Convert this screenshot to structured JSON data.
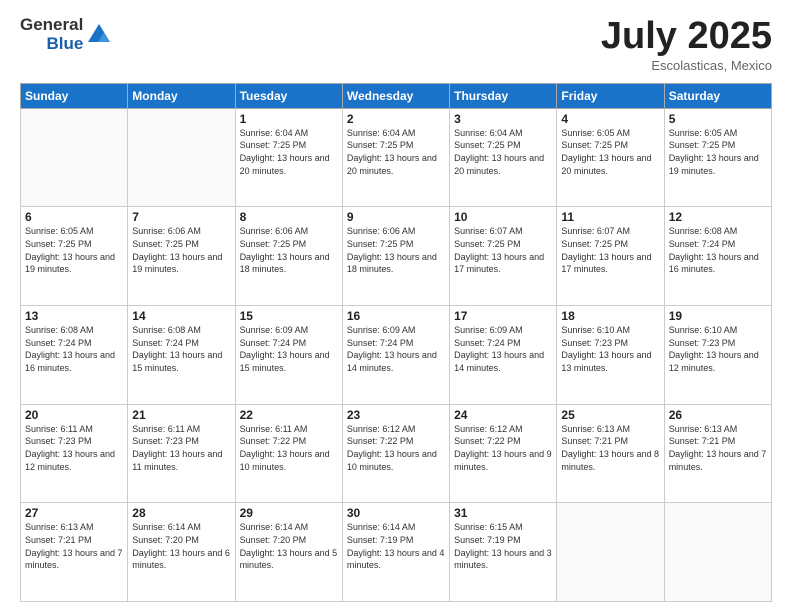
{
  "logo": {
    "general": "General",
    "blue": "Blue"
  },
  "title": "July 2025",
  "location": "Escolasticas, Mexico",
  "days_header": [
    "Sunday",
    "Monday",
    "Tuesday",
    "Wednesday",
    "Thursday",
    "Friday",
    "Saturday"
  ],
  "weeks": [
    [
      {
        "day": "",
        "info": ""
      },
      {
        "day": "",
        "info": ""
      },
      {
        "day": "1",
        "info": "Sunrise: 6:04 AM\nSunset: 7:25 PM\nDaylight: 13 hours and 20 minutes."
      },
      {
        "day": "2",
        "info": "Sunrise: 6:04 AM\nSunset: 7:25 PM\nDaylight: 13 hours and 20 minutes."
      },
      {
        "day": "3",
        "info": "Sunrise: 6:04 AM\nSunset: 7:25 PM\nDaylight: 13 hours and 20 minutes."
      },
      {
        "day": "4",
        "info": "Sunrise: 6:05 AM\nSunset: 7:25 PM\nDaylight: 13 hours and 20 minutes."
      },
      {
        "day": "5",
        "info": "Sunrise: 6:05 AM\nSunset: 7:25 PM\nDaylight: 13 hours and 19 minutes."
      }
    ],
    [
      {
        "day": "6",
        "info": "Sunrise: 6:05 AM\nSunset: 7:25 PM\nDaylight: 13 hours and 19 minutes."
      },
      {
        "day": "7",
        "info": "Sunrise: 6:06 AM\nSunset: 7:25 PM\nDaylight: 13 hours and 19 minutes."
      },
      {
        "day": "8",
        "info": "Sunrise: 6:06 AM\nSunset: 7:25 PM\nDaylight: 13 hours and 18 minutes."
      },
      {
        "day": "9",
        "info": "Sunrise: 6:06 AM\nSunset: 7:25 PM\nDaylight: 13 hours and 18 minutes."
      },
      {
        "day": "10",
        "info": "Sunrise: 6:07 AM\nSunset: 7:25 PM\nDaylight: 13 hours and 17 minutes."
      },
      {
        "day": "11",
        "info": "Sunrise: 6:07 AM\nSunset: 7:25 PM\nDaylight: 13 hours and 17 minutes."
      },
      {
        "day": "12",
        "info": "Sunrise: 6:08 AM\nSunset: 7:24 PM\nDaylight: 13 hours and 16 minutes."
      }
    ],
    [
      {
        "day": "13",
        "info": "Sunrise: 6:08 AM\nSunset: 7:24 PM\nDaylight: 13 hours and 16 minutes."
      },
      {
        "day": "14",
        "info": "Sunrise: 6:08 AM\nSunset: 7:24 PM\nDaylight: 13 hours and 15 minutes."
      },
      {
        "day": "15",
        "info": "Sunrise: 6:09 AM\nSunset: 7:24 PM\nDaylight: 13 hours and 15 minutes."
      },
      {
        "day": "16",
        "info": "Sunrise: 6:09 AM\nSunset: 7:24 PM\nDaylight: 13 hours and 14 minutes."
      },
      {
        "day": "17",
        "info": "Sunrise: 6:09 AM\nSunset: 7:24 PM\nDaylight: 13 hours and 14 minutes."
      },
      {
        "day": "18",
        "info": "Sunrise: 6:10 AM\nSunset: 7:23 PM\nDaylight: 13 hours and 13 minutes."
      },
      {
        "day": "19",
        "info": "Sunrise: 6:10 AM\nSunset: 7:23 PM\nDaylight: 13 hours and 12 minutes."
      }
    ],
    [
      {
        "day": "20",
        "info": "Sunrise: 6:11 AM\nSunset: 7:23 PM\nDaylight: 13 hours and 12 minutes."
      },
      {
        "day": "21",
        "info": "Sunrise: 6:11 AM\nSunset: 7:23 PM\nDaylight: 13 hours and 11 minutes."
      },
      {
        "day": "22",
        "info": "Sunrise: 6:11 AM\nSunset: 7:22 PM\nDaylight: 13 hours and 10 minutes."
      },
      {
        "day": "23",
        "info": "Sunrise: 6:12 AM\nSunset: 7:22 PM\nDaylight: 13 hours and 10 minutes."
      },
      {
        "day": "24",
        "info": "Sunrise: 6:12 AM\nSunset: 7:22 PM\nDaylight: 13 hours and 9 minutes."
      },
      {
        "day": "25",
        "info": "Sunrise: 6:13 AM\nSunset: 7:21 PM\nDaylight: 13 hours and 8 minutes."
      },
      {
        "day": "26",
        "info": "Sunrise: 6:13 AM\nSunset: 7:21 PM\nDaylight: 13 hours and 7 minutes."
      }
    ],
    [
      {
        "day": "27",
        "info": "Sunrise: 6:13 AM\nSunset: 7:21 PM\nDaylight: 13 hours and 7 minutes."
      },
      {
        "day": "28",
        "info": "Sunrise: 6:14 AM\nSunset: 7:20 PM\nDaylight: 13 hours and 6 minutes."
      },
      {
        "day": "29",
        "info": "Sunrise: 6:14 AM\nSunset: 7:20 PM\nDaylight: 13 hours and 5 minutes."
      },
      {
        "day": "30",
        "info": "Sunrise: 6:14 AM\nSunset: 7:19 PM\nDaylight: 13 hours and 4 minutes."
      },
      {
        "day": "31",
        "info": "Sunrise: 6:15 AM\nSunset: 7:19 PM\nDaylight: 13 hours and 3 minutes."
      },
      {
        "day": "",
        "info": ""
      },
      {
        "day": "",
        "info": ""
      }
    ]
  ]
}
